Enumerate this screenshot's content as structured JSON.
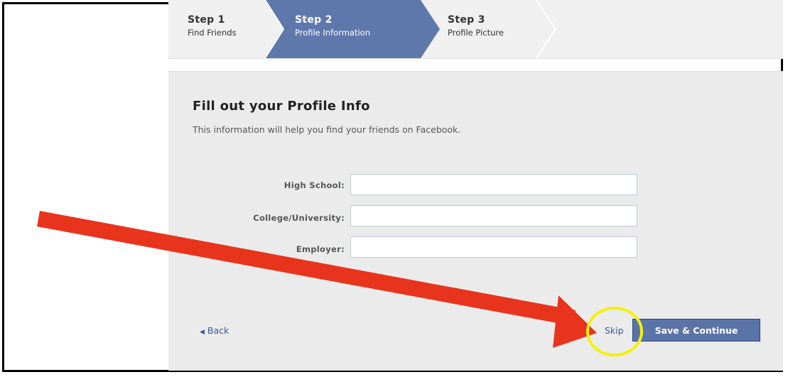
{
  "wizard": {
    "steps": [
      {
        "number": "Step 1",
        "label": "Find Friends"
      },
      {
        "number": "Step 2",
        "label": "Profile Information"
      },
      {
        "number": "Step 3",
        "label": "Profile Picture"
      }
    ],
    "active_step": 2
  },
  "form": {
    "title": "Fill out your Profile Info",
    "subtitle": "This information will help you find your friends on Facebook.",
    "fields": [
      {
        "label": "High School:",
        "value": ""
      },
      {
        "label": "College/University:",
        "value": ""
      },
      {
        "label": "Employer:",
        "value": ""
      }
    ]
  },
  "actions": {
    "back_label": "Back",
    "skip_label": "Skip",
    "save_label": "Save & Continue"
  },
  "annotation": {
    "arrow": "red-arrow",
    "highlight": "yellow-circle",
    "arrow_color": "#e8341c",
    "circle_color": "#f2f20a"
  },
  "colors": {
    "active_step": "#5f78ab",
    "link": "#3b5998",
    "button": "#5b74a8"
  }
}
